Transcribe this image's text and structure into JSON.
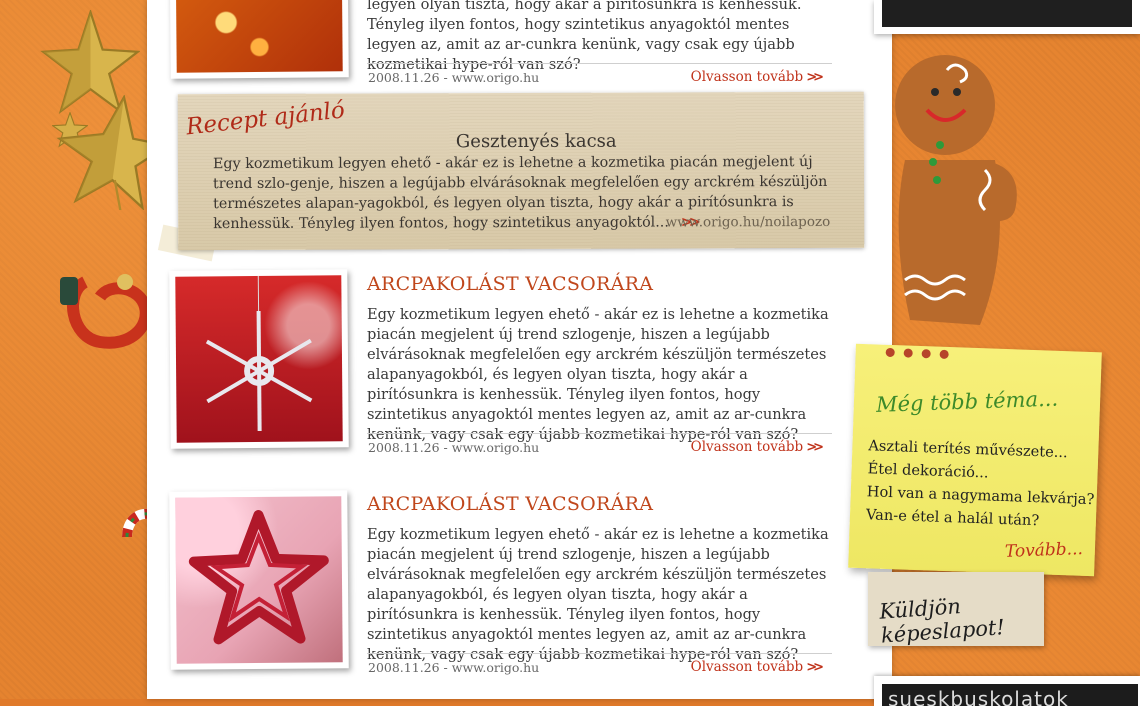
{
  "articles": [
    {
      "title": "",
      "body": "legyen olyan tiszta, hogy akár a pirítósunkra is kenhessük. Tényleg ilyen fontos, hogy szintetikus anyagoktól mentes legyen az, amit az ar-cunkra kenünk, vagy csak egy újabb kozmetikai hype-ról van szó?",
      "date": "2008.11.26  -  www.origo.hu",
      "more": "Olvasson tovább"
    },
    {
      "title": "ARCPAKOLÁST VACSORÁRA",
      "body": "Egy kozmetikum legyen ehető - akár ez is lehetne a kozmetika piacán megjelent új trend szlogenje, hiszen a legújabb elvárásoknak megfelelően egy arckrém készüljön természetes alapanyagokból, és legyen olyan tiszta, hogy akár a pirítósunkra is kenhessük. Tényleg ilyen fontos, hogy szintetikus anyagoktól mentes legyen az, amit az ar-cunkra kenünk, vagy csak egy újabb kozmetikai hype-ról van szó?",
      "date": "2008.11.26  -  www.origo.hu",
      "more": "Olvasson tovább"
    },
    {
      "title": "ARCPAKOLÁST VACSORÁRA",
      "body": "Egy kozmetikum legyen ehető - akár ez is lehetne a kozmetika piacán megjelent új trend szlogenje, hiszen a legújabb elvárásoknak megfelelően egy arckrém készüljön természetes alapanyagokból, és legyen olyan tiszta, hogy akár a pirítósunkra is kenhessük. Tényleg ilyen fontos, hogy szintetikus anyagoktól mentes legyen az, amit az ar-cunkra kenünk, vagy csak egy újabb kozmetikai hype-ról van szó?",
      "date": "2008.11.26  -  www.origo.hu",
      "more": "Olvasson tovább"
    }
  ],
  "recipe": {
    "tag": "Recept ajánló",
    "title": "Gesztenyés kacsa",
    "body": "Egy kozmetikum legyen ehető - akár ez is lehetne a kozmetika piacán megjelent új trend szlo-genje, hiszen a legújabb elvárásoknak megfelelően egy arckrém készüljön természetes alapan-yagokból, és legyen olyan tiszta, hogy akár a pirítósunkra is kenhessük. Tényleg ilyen fontos, hogy szintetikus anyagoktól...",
    "source": "www.origo.hu/noilapozo"
  },
  "sidebar_note": {
    "title": "Még több téma...",
    "items": [
      "Asztali terítés művészete...",
      "Étel dekoráció...",
      "Hol van a nagymama lekvárja?",
      "Van-e étel a halál után?"
    ],
    "more": "Tovább..."
  },
  "postcard": {
    "label": "Küldjön képeslapot!"
  },
  "bottom_banner": {
    "text": "sueskbuskolatok"
  },
  "colors": {
    "accent": "#c0471c",
    "link": "#c0321a",
    "page_bg": "#e5832f"
  }
}
